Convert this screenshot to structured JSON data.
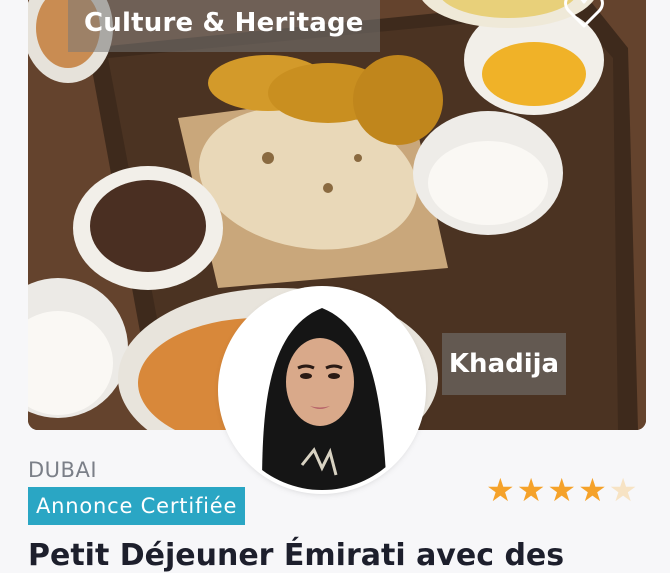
{
  "listing": {
    "category": "Culture & Heritage",
    "host_name": "Khadija",
    "city": "DUBAI",
    "badge": "Annonce Certifiée",
    "title": "Petit Déjeuner Émirati avec des",
    "rating": 4,
    "rating_max": 5
  },
  "icons": {
    "favorite": "heart-outline-icon",
    "star": "star-icon"
  },
  "colors": {
    "badge_bg": "#2aa6c4",
    "star_on": "#f5a22a",
    "star_off": "#f7e3c4",
    "title": "#1d1f2c",
    "city": "#7b7f88"
  }
}
